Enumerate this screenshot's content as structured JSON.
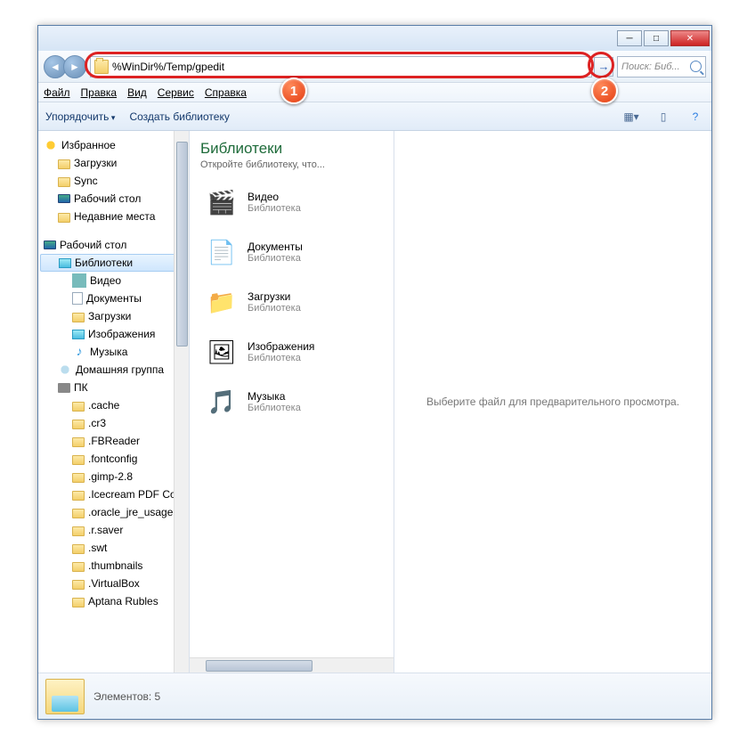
{
  "address": {
    "path": "%WinDir%/Temp/gpedit"
  },
  "search": {
    "placeholder": "Поиск: Биб..."
  },
  "menu": {
    "file": "Файл",
    "edit": "Правка",
    "view": "Вид",
    "tools": "Сервис",
    "help": "Справка"
  },
  "toolbar": {
    "organize": "Упорядочить",
    "newlib": "Создать библиотеку"
  },
  "sidebar": {
    "favorites": "Избранное",
    "downloads": "Загрузки",
    "sync": "Sync",
    "desktop": "Рабочий стол",
    "recent": "Недавние места",
    "desktop2": "Рабочий стол",
    "libraries": "Библиотеки",
    "video": "Видео",
    "documents": "Документы",
    "downloads2": "Загрузки",
    "images": "Изображения",
    "music": "Музыка",
    "homegroup": "Домашняя группа",
    "pc": "ПК",
    "folders": [
      ".cache",
      ".cr3",
      ".FBReader",
      ".fontconfig",
      ".gimp-2.8",
      ".Icecream PDF Conv",
      ".oracle_jre_usage",
      ".r.saver",
      ".swt",
      ".thumbnails",
      ".VirtualBox",
      "Aptana Rubles"
    ]
  },
  "content": {
    "title": "Библиотеки",
    "subtitle": "Откройте библиотеку, что...",
    "items": [
      {
        "name": "Видео",
        "type": "Библиотека"
      },
      {
        "name": "Документы",
        "type": "Библиотека"
      },
      {
        "name": "Загрузки",
        "type": "Библиотека"
      },
      {
        "name": "Изображения",
        "type": "Библиотека"
      },
      {
        "name": "Музыка",
        "type": "Библиотека"
      }
    ]
  },
  "preview": {
    "empty": "Выберите файл для предварительного просмотра."
  },
  "status": {
    "count": "Элементов: 5"
  },
  "callouts": {
    "one": "1",
    "two": "2"
  }
}
